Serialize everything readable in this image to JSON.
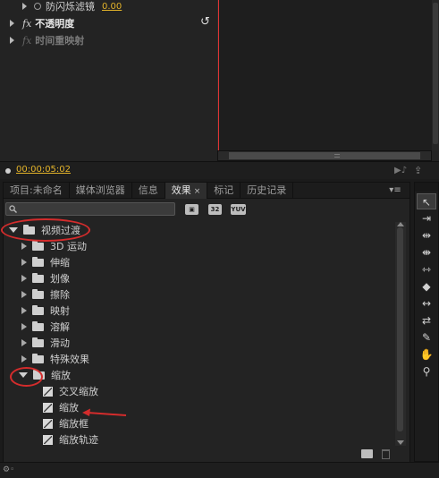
{
  "effect_controls": {
    "rows": [
      {
        "label": "防闪烁滤镜",
        "value": "0.00"
      },
      {
        "label": "不透明度"
      },
      {
        "label": "时间重映射"
      }
    ],
    "fx_label": "fx",
    "timecode": "00:00:05:02"
  },
  "tabs": [
    {
      "label": "项目:未命名"
    },
    {
      "label": "媒体浏览器"
    },
    {
      "label": "信息"
    },
    {
      "label": "效果",
      "close": "×",
      "active": true
    },
    {
      "label": "标记"
    },
    {
      "label": "历史记录"
    }
  ],
  "panel_menu_icon": "panel-menu-icon",
  "search": {
    "value": "",
    "placeholder": ""
  },
  "filter_buttons": [
    "32",
    "YUV"
  ],
  "tree": [
    {
      "label": "视频过渡",
      "state": "expanded",
      "kind": "folder"
    },
    {
      "label": "3D 运动",
      "state": "collapsed",
      "kind": "folder"
    },
    {
      "label": "伸缩",
      "state": "collapsed",
      "kind": "folder"
    },
    {
      "label": "划像",
      "state": "collapsed",
      "kind": "folder"
    },
    {
      "label": "擦除",
      "state": "collapsed",
      "kind": "folder"
    },
    {
      "label": "映射",
      "state": "collapsed",
      "kind": "folder"
    },
    {
      "label": "溶解",
      "state": "collapsed",
      "kind": "folder"
    },
    {
      "label": "滑动",
      "state": "collapsed",
      "kind": "folder"
    },
    {
      "label": "特殊效果",
      "state": "collapsed",
      "kind": "folder"
    },
    {
      "label": "缩放",
      "state": "expanded",
      "kind": "folder"
    },
    {
      "label": "交叉缩放",
      "kind": "preset"
    },
    {
      "label": "缩放",
      "kind": "preset"
    },
    {
      "label": "缩放框",
      "kind": "preset"
    },
    {
      "label": "缩放轨迹",
      "kind": "preset"
    }
  ],
  "tools": [
    {
      "name": "selection-tool-icon",
      "glyph": "↖"
    },
    {
      "name": "track-select-tool-icon",
      "glyph": "⇥"
    },
    {
      "name": "ripple-edit-tool-icon",
      "glyph": "⇹"
    },
    {
      "name": "rolling-edit-tool-icon",
      "glyph": "⇼"
    },
    {
      "name": "rate-stretch-tool-icon",
      "glyph": "⇿"
    },
    {
      "name": "razor-tool-icon",
      "glyph": "◆"
    },
    {
      "name": "slip-tool-icon",
      "glyph": "↔"
    },
    {
      "name": "slide-tool-icon",
      "glyph": "⇄"
    },
    {
      "name": "pen-tool-icon",
      "glyph": "✎"
    },
    {
      "name": "hand-tool-icon",
      "glyph": "✋"
    },
    {
      "name": "zoom-tool-icon",
      "glyph": "⚲"
    }
  ],
  "annotation_color": "#d42c2c",
  "timecode_color": "#e3b32a",
  "playhead_color": "#e03434"
}
